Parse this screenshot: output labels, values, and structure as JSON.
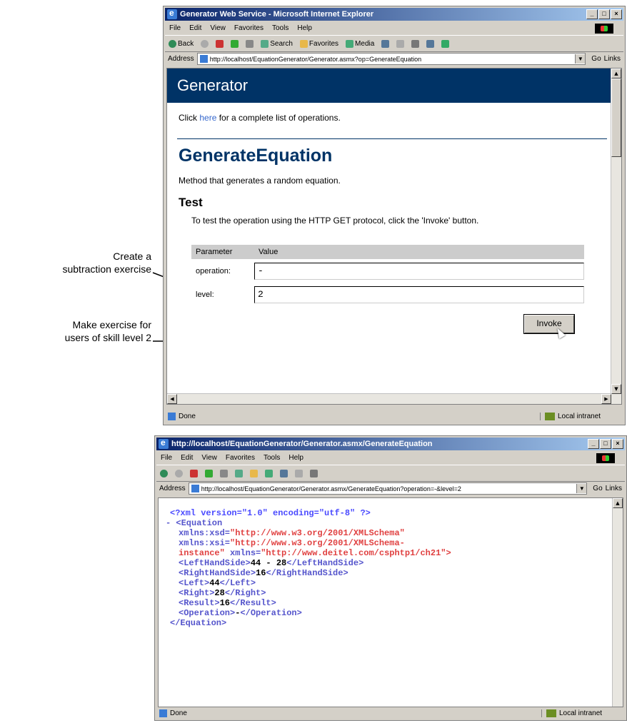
{
  "window1": {
    "title": "Generator Web Service - Microsoft Internet Explorer",
    "menu": [
      "File",
      "Edit",
      "View",
      "Favorites",
      "Tools",
      "Help"
    ],
    "toolbar": {
      "back": "Back",
      "search": "Search",
      "favorites": "Favorites",
      "media": "Media"
    },
    "address_label": "Address",
    "address": "http://localhost/EquationGenerator/Generator.asmx?op=GenerateEquation",
    "go": "Go",
    "links": "Links",
    "banner": "Generator",
    "intro_pre": "Click ",
    "intro_link": "here",
    "intro_post": " for a complete list of operations.",
    "heading": "GenerateEquation",
    "description": "Method that generates a random equation.",
    "test_heading": "Test",
    "instructions": "To test the operation using the HTTP GET protocol, click the 'Invoke' button.",
    "param_header": "Parameter",
    "value_header": "Value",
    "params": [
      {
        "name": "operation:",
        "value": "-"
      },
      {
        "name": "level:",
        "value": "2"
      }
    ],
    "invoke": "Invoke",
    "status": "Done",
    "zone": "Local intranet"
  },
  "window2": {
    "title": "http://localhost/EquationGenerator/Generator.asmx/GenerateEquation",
    "menu": [
      "File",
      "Edit",
      "View",
      "Favorites",
      "Tools",
      "Help"
    ],
    "address_label": "Address",
    "address": "http://localhost/EquationGenerator/Generator.asmx/GenerateEquation?operation=-&level=2",
    "go": "Go",
    "links": "Links",
    "xml": {
      "decl": "<?xml version=\"1.0\" encoding=\"utf-8\" ?>",
      "root_open": "- <Equation",
      "xmlns_xsd_attr": "xmlns:xsd=",
      "xmlns_xsd_val": "\"http://www.w3.org/2001/XMLSchema\"",
      "xmlns_xsi_attr": "xmlns:xsi=",
      "xmlns_xsi_val": "\"http://www.w3.org/2001/XMLSchema-",
      "xmlns_xsi_val2": "instance\"",
      "xmlns_attr": "xmlns=",
      "xmlns_val": "\"http://www.deitel.com/csphtp1/ch21\">",
      "lhs_open": "<LeftHandSide>",
      "lhs_val": "44 - 28",
      "lhs_close": "</LeftHandSide>",
      "rhs_open": "<RightHandSide>",
      "rhs_val": "16",
      "rhs_close": "</RightHandSide>",
      "left_open": "<Left>",
      "left_val": "44",
      "left_close": "</Left>",
      "right_open": "<Right>",
      "right_val": "28",
      "right_close": "</Right>",
      "result_open": "<Result>",
      "result_val": "16",
      "result_close": "</Result>",
      "op_open": "<Operation>",
      "op_val": "-",
      "op_close": "</Operation>",
      "root_close": "</Equation>"
    },
    "status": "Done",
    "zone": "Local intranet"
  },
  "callouts": {
    "subtraction_line1": "Create a",
    "subtraction_line2": "subtraction exercise",
    "level_line1": "Make exercise for",
    "level_line2": "users of skill level 2"
  }
}
